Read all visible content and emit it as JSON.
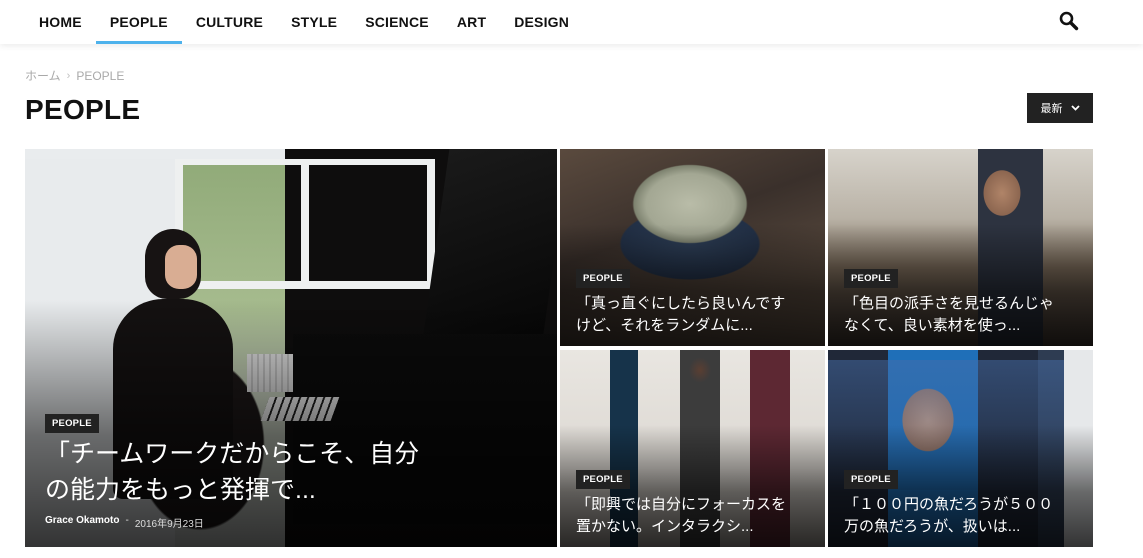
{
  "nav": {
    "items": [
      {
        "label": "HOME",
        "active": false
      },
      {
        "label": "PEOPLE",
        "active": true
      },
      {
        "label": "CULTURE",
        "active": false
      },
      {
        "label": "STYLE",
        "active": false
      },
      {
        "label": "SCIENCE",
        "active": false
      },
      {
        "label": "ART",
        "active": false
      },
      {
        "label": "DESIGN",
        "active": false
      }
    ],
    "search_icon": "search-icon",
    "active_color": "#4db2ec"
  },
  "breadcrumb": {
    "home": "ホーム",
    "current": "PEOPLE"
  },
  "page": {
    "title": "PEOPLE",
    "sort_label": "最新",
    "sort_icon": "chevron-down-icon"
  },
  "featured": {
    "category": "PEOPLE",
    "title_line1": "「チームワークだからこそ、自分",
    "title_line2": "の能力をもっと発揮で...",
    "author": "Grace Okamoto",
    "separator": "-",
    "date": "2016年9月23日"
  },
  "articles": [
    {
      "category": "PEOPLE",
      "title_line1": "「真っ直ぐにしたら良いんです",
      "title_line2": "けど、それをランダムに..."
    },
    {
      "category": "PEOPLE",
      "title_line1": "「色目の派手さを見せるんじゃ",
      "title_line2": "なくて、良い素材を使っ..."
    },
    {
      "category": "PEOPLE",
      "title_line1": "「即興では自分にフォーカスを",
      "title_line2": "置かない。インタラクシ..."
    },
    {
      "category": "PEOPLE",
      "title_line1": "「１００円の魚だろうが５００",
      "title_line2": "万の魚だろうが、扱いは..."
    }
  ]
}
